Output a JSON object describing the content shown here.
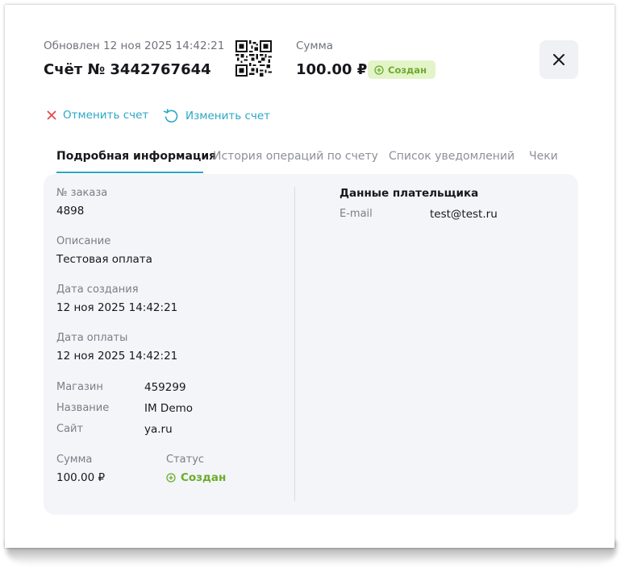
{
  "header": {
    "updated_text": "Обновлен 12 ноя 2025 14:42:21",
    "invoice_title": "Счёт № 3442767644",
    "sum_label": "Сумма",
    "sum_value": "100.00 ₽",
    "status_badge": "Создан"
  },
  "actions": {
    "cancel_label": "Отменить счет",
    "edit_label": "Изменить счет"
  },
  "tabs": [
    {
      "label": "Подробная информация",
      "active": true
    },
    {
      "label": "История операций по счету",
      "active": false
    },
    {
      "label": "Список уведомлений",
      "active": false
    },
    {
      "label": "Чеки",
      "active": false
    }
  ],
  "details": {
    "order_label": "№ заказа",
    "order_value": "4898",
    "description_label": "Описание",
    "description_value": "Тестовая оплата",
    "created_label": "Дата создания",
    "created_value": "12 ноя 2025 14:42:21",
    "paid_label": "Дата оплаты",
    "paid_value": "12 ноя 2025 14:42:21",
    "shop_label": "Магазин",
    "shop_value": "459299",
    "name_label": "Название",
    "name_value": "IM Demo",
    "site_label": "Сайт",
    "site_value": "ya.ru",
    "sum_label": "Сумма",
    "sum_value": "100.00 ₽",
    "status_label": "Статус",
    "status_value": "Создан"
  },
  "payer": {
    "title": "Данные плательщика",
    "email_label": "E-mail",
    "email_value": "test@test.ru"
  },
  "colors": {
    "accent": "#2ba7c7",
    "success": "#6cab2c",
    "success_bg": "#e3f4c9",
    "danger": "#e5484d",
    "panel_bg": "#f3f5f9"
  },
  "icons": {
    "close": "close-icon",
    "cancel": "cross-icon",
    "edit": "refresh-icon",
    "status": "plus-circle-icon",
    "qr": "qr-code-icon"
  }
}
